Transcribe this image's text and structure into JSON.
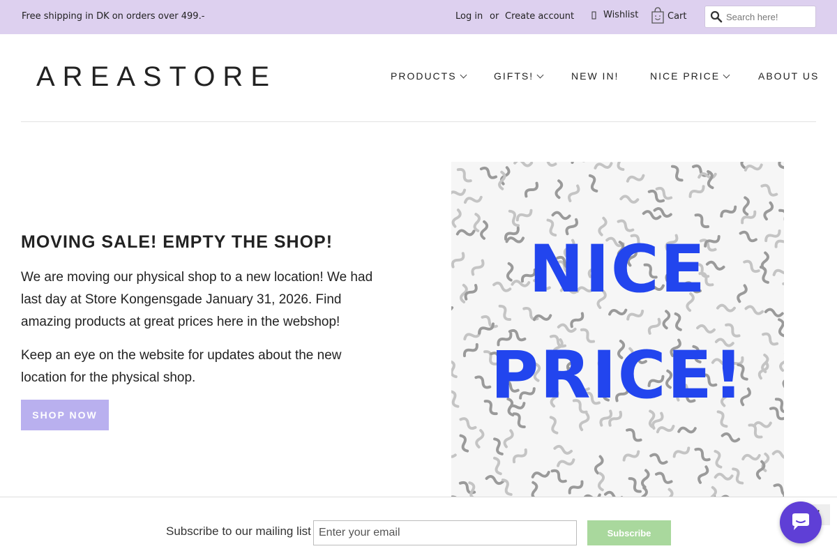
{
  "topbar": {
    "promo": "Free shipping in DK on orders over 499.-",
    "login": "Log in",
    "or": "or",
    "create_account": "Create account",
    "wishlist": "Wishlist",
    "cart": "Cart",
    "search_placeholder": "Search here!"
  },
  "header": {
    "logo": "AREASTORE",
    "nav": [
      {
        "label": "PRODUCTS",
        "has_dropdown": true
      },
      {
        "label": "GIFTS!",
        "has_dropdown": true
      },
      {
        "label": "NEW IN!",
        "has_dropdown": false
      },
      {
        "label": "NICE PRICE",
        "has_dropdown": true
      },
      {
        "label": "ABOUT US",
        "has_dropdown": false
      }
    ]
  },
  "hero": {
    "title": "MOVING SALE! EMPTY THE SHOP!",
    "paragraph1": "We are moving our physical shop to a new location! We had last day at Store Kongensgade January 31, 2026. Find amazing products at great prices here in the webshop!",
    "paragraph2": "Keep an eye on the website for updates about the new location for the physical shop.",
    "button": "SHOP NOW",
    "image_text_line1": "NICE",
    "image_text_line2": "PRICE!"
  },
  "subscribe": {
    "label": "Subscribe to our mailing list",
    "placeholder": "Enter your email",
    "button": "Subscribe"
  },
  "icons": [
    "heart-icon",
    "bag-icon",
    "search-icon",
    "chevron-down-icon",
    "close-icon",
    "chat-icon"
  ],
  "colors": {
    "topbar_bg": "#ddd0ef",
    "shop_button": "#b9b0ef",
    "subscribe_button": "#a9d89d",
    "image_text": "#2245ee",
    "chat_button": "#5f3fd6"
  }
}
